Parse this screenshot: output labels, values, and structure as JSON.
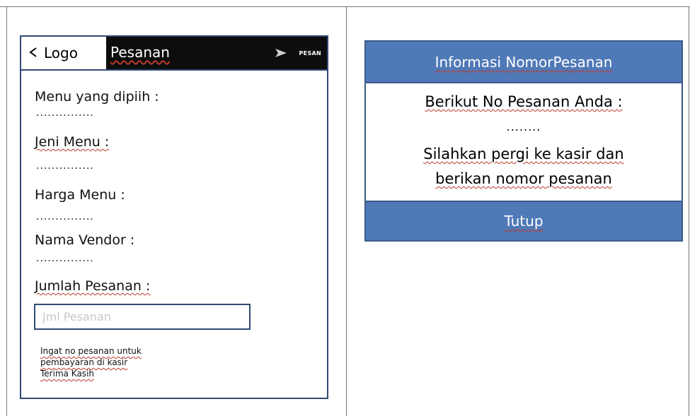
{
  "phone": {
    "back_icon": "chevron-left-icon",
    "logo_label": "Logo",
    "title": "Pesanan",
    "send_icon": "send-icon",
    "send_label": "PESAN",
    "fields": [
      {
        "label": "Menu yang dipiih :",
        "value": "..............."
      },
      {
        "label": "Jeni Menu :",
        "value": "..............."
      },
      {
        "label": "Harga Menu :",
        "value": "..............."
      },
      {
        "label": "Nama Vendor :",
        "value": "..............."
      }
    ],
    "quantity": {
      "label": "Jumlah Pesanan :",
      "placeholder": "Jml Pesanan",
      "value": ""
    },
    "note_lines": [
      "Ingat no pesanan untuk",
      "pembayaran di kasir",
      "Terima Kasih"
    ]
  },
  "dialog": {
    "title": "Informasi NomorPesanan",
    "line1": "Berikut No Pesanan Anda :",
    "order_number": "........",
    "line3": "Silahkan pergi ke kasir dan",
    "line4": "berikan nomor  pesanan",
    "close_label": "Tutup"
  },
  "colors": {
    "border": "#2f4a75",
    "dialog_blue": "#5079b8",
    "topbar_dark": "#0d0d0d"
  }
}
